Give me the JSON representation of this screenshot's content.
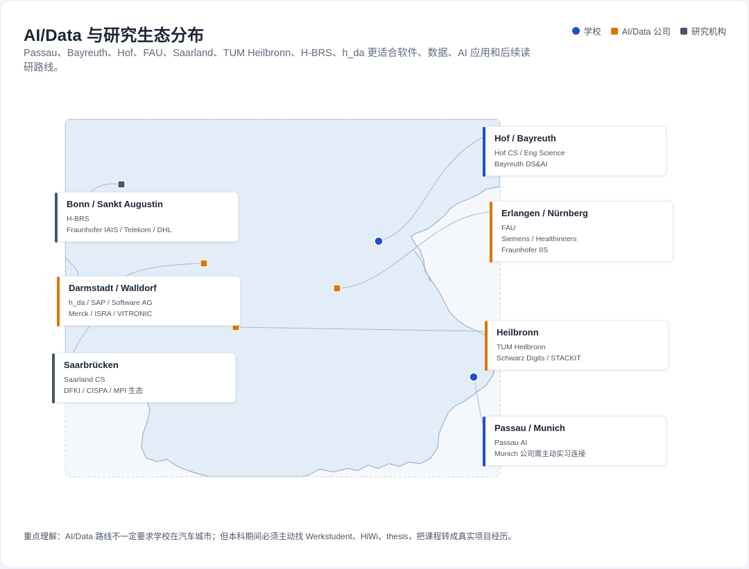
{
  "header": {
    "title": "AI/Data 与研究生态分布",
    "subtitle": "Passau、Bayreuth、Hof、FAU、Saarland、TUM Heilbronn、H-BRS、h_da 更适合软件、数据、AI 应用和后续读研路线。"
  },
  "legend": {
    "school": "学校",
    "company": "AI/Data 公司",
    "research": "研究机构"
  },
  "colors": {
    "school": "#1f4fd1",
    "company": "#d97706",
    "research": "#475569",
    "map_fill": "#e3edf7",
    "map_stroke": "#9fb3c8"
  },
  "boxes": {
    "hof": {
      "title": "Hof / Bayreuth",
      "lines": [
        "Hof CS / Eng Science",
        "Bayreuth DS&AI"
      ],
      "category": "school"
    },
    "bonn": {
      "title": "Bonn / Sankt Augustin",
      "lines": [
        "H-BRS",
        "Fraunhofer IAIS / Telekom / DHL"
      ],
      "category": "research"
    },
    "erlangen": {
      "title": "Erlangen / Nürnberg",
      "lines": [
        "FAU",
        "Siemens / Healthineers",
        "Fraunhofer IIS"
      ],
      "category": "company"
    },
    "darmstadt": {
      "title": "Darmstadt / Walldorf",
      "lines": [
        "h_da / SAP / Software AG",
        "Merck / ISRA / VITRONIC"
      ],
      "category": "company"
    },
    "heilbronn": {
      "title": "Heilbronn",
      "lines": [
        "TUM Heilbronn",
        "Schwarz Digits / STACKIT"
      ],
      "category": "company"
    },
    "saarbruecken": {
      "title": "Saarbrücken",
      "lines": [
        "Saarland CS",
        "DFKI / CISPA / MPI 生态"
      ],
      "category": "research"
    },
    "passau": {
      "title": "Passau / Munich",
      "lines": [
        "Passau AI",
        "Munich 公司需主动实习连接"
      ],
      "category": "school"
    }
  },
  "footer": {
    "note": "重点理解：AI/Data 路线不一定要求学校在汽车城市；但本科期间必须主动找 Werkstudent、HiWi、thesis，把课程转成真实项目经历。"
  }
}
